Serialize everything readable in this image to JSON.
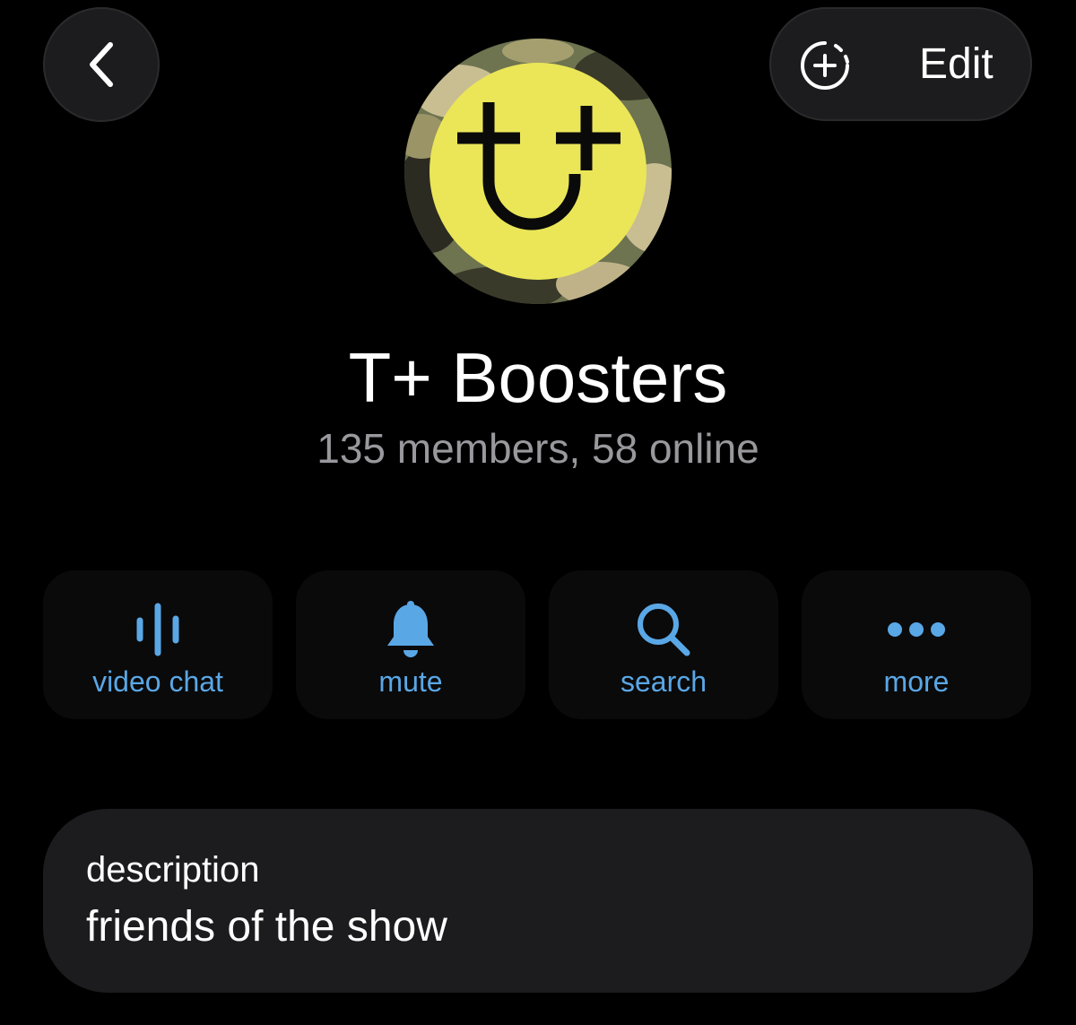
{
  "header": {
    "back_icon": "chevron-left-icon",
    "story_icon": "add-story-icon",
    "edit_label": "Edit"
  },
  "group": {
    "avatar_letters": "t+",
    "avatar_colors": {
      "ring": "#7c8260",
      "disc": "#eae658",
      "glyph": "#0a0a0a"
    },
    "name": "T+ Boosters",
    "status": "135 members, 58 online"
  },
  "actions": [
    {
      "label": "video chat",
      "icon": "voice-chat-icon"
    },
    {
      "label": "mute",
      "icon": "bell-icon"
    },
    {
      "label": "search",
      "icon": "search-icon"
    },
    {
      "label": "more",
      "icon": "more-dots-icon"
    }
  ],
  "info": {
    "key": "description",
    "value": "friends of the show"
  },
  "colors": {
    "accent": "#5aa7e6",
    "background": "#000000",
    "card": "#1c1c1e",
    "secondary_text": "#98989d"
  }
}
